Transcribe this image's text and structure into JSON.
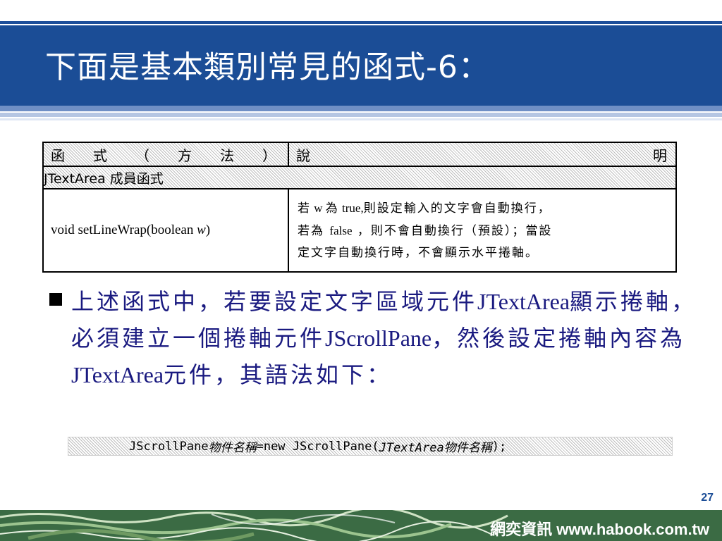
{
  "slide": {
    "title": "下面是基本類別常見的函式-6：",
    "page_number": "27"
  },
  "table": {
    "header_left_chars": [
      "函",
      "式",
      "（",
      "方",
      "法",
      "）"
    ],
    "header_right_chars": [
      "說",
      "明"
    ],
    "section_label": "JTextArea 成員函式",
    "row": {
      "method_prefix": "void setLineWrap(boolean ",
      "method_param": "w",
      "method_suffix": ")",
      "desc_line1_a": "若",
      "desc_line1_b": " w ",
      "desc_line1_c": "為",
      "desc_line1_d": " true,",
      "desc_line1_e": "則設定輸入的文字會自動換行，",
      "desc_line2_a": "若為 ",
      "desc_line2_b": "false",
      "desc_line2_c": " ，則不會自動換行（預設）；當設",
      "desc_line3": "定文字自動換行時，不會顯示水平捲軸。"
    }
  },
  "bullet": {
    "seg1": "上述函式中，若要設定文字區域元件",
    "seg2": "JTextArea",
    "seg3": "顯示捲軸，必須建立一個捲軸元件",
    "seg4": "JScrollPane",
    "seg5": "，然後設定捲軸內容為",
    "seg6": "JTextArea",
    "seg7": "元件，其語法如下："
  },
  "code": {
    "part1": "JScrollPane ",
    "part2": "物件名稱",
    "part3": "=new JScrollPane(",
    "part4": "JTextArea物件名稱",
    "part5": ");"
  },
  "footer": {
    "brand": "網奕資訊 www.habook.com.tw"
  },
  "colors": {
    "title_band": "#1b4d96",
    "bullet_text": "#1a1a80",
    "footer_bg": "#3b6b44"
  }
}
